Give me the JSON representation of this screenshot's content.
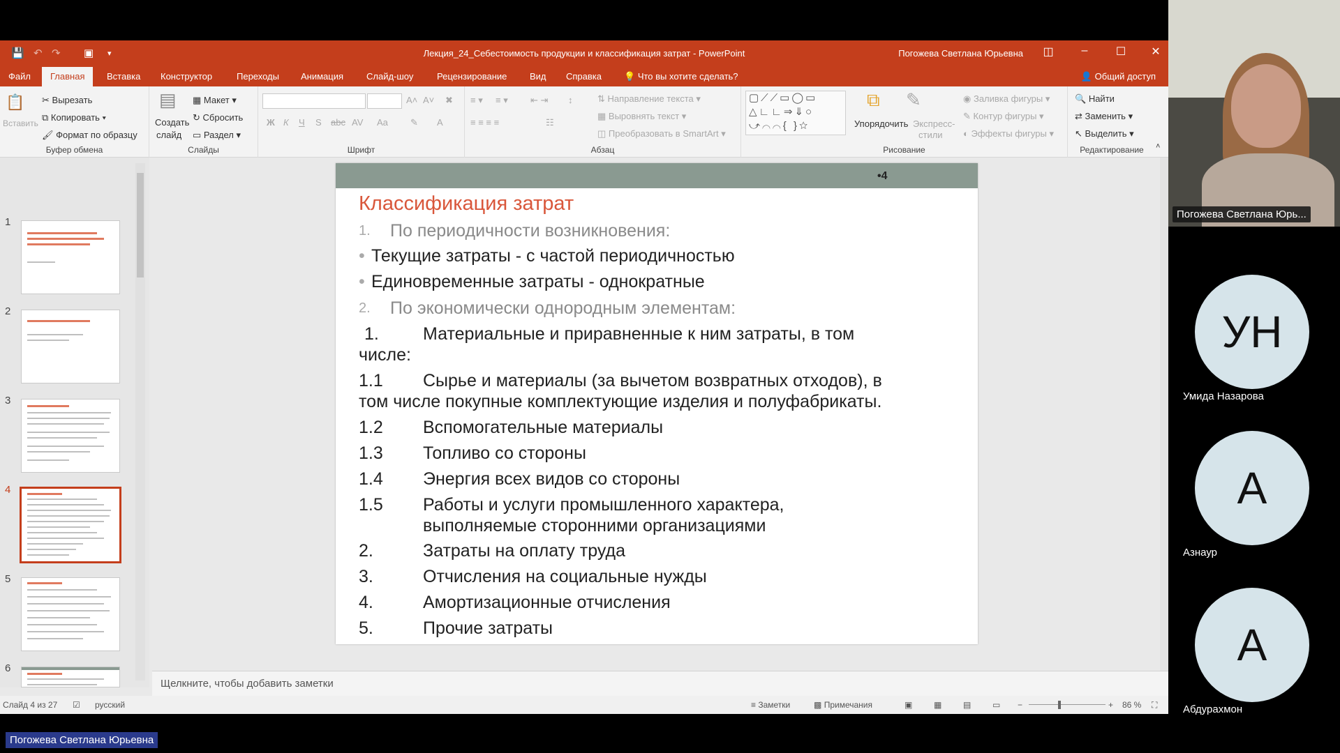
{
  "window": {
    "title": "Лекция_24_Себестоимость продукции и классификация затрат  -  PowerPoint",
    "user": "Погожева Светлана Юрьевна"
  },
  "tabs": [
    "Файл",
    "Главная",
    "Вставка",
    "Конструктор",
    "Переходы",
    "Анимация",
    "Слайд-шоу",
    "Рецензирование",
    "Вид",
    "Справка"
  ],
  "tell_me": "Что вы хотите сделать?",
  "share": "Общий доступ",
  "ribbon": {
    "clipboard": {
      "paste": "Вставить",
      "cut": "Вырезать",
      "copy": "Копировать",
      "format_painter": "Формат по образцу",
      "label": "Буфер обмена"
    },
    "slides": {
      "new_slide_1": "Создать",
      "new_slide_2": "слайд",
      "layout": "Макет",
      "reset": "Сбросить",
      "section": "Раздел",
      "label": "Слайды"
    },
    "font": {
      "label": "Шрифт",
      "bold": "Ж",
      "italic": "К",
      "underline": "Ч",
      "shadow": "S",
      "strike": "abc",
      "spacing": "AV",
      "case": "Aa"
    },
    "paragraph": {
      "text_direction": "Направление текста",
      "align_text": "Выровнять текст",
      "smartart": "Преобразовать в SmartArt",
      "label": "Абзац"
    },
    "drawing": {
      "arrange": "Упорядочить",
      "quick_styles_1": "Экспресс-",
      "quick_styles_2": "стили",
      "shape_fill": "Заливка фигуры",
      "shape_outline": "Контур фигуры",
      "shape_effects": "Эффекты фигуры",
      "label": "Рисование"
    },
    "editing": {
      "find": "Найти",
      "replace": "Заменить",
      "select": "Выделить",
      "label": "Редактирование"
    }
  },
  "thumbnails": [
    "1",
    "2",
    "3",
    "4",
    "5",
    "6"
  ],
  "slide": {
    "number": "•4",
    "title": "Классификация затрат",
    "lines": [
      {
        "no": "1.",
        "text": "По периодичности возникновения:",
        "style": "grey"
      },
      {
        "no": "•",
        "text": "Текущие затраты - с частой периодичностью",
        "style": "bullet"
      },
      {
        "no": "•",
        "text": "Единовременные затраты - однократные",
        "style": "bullet"
      },
      {
        "no": "2.",
        "text": "По экономически однородным элементам:",
        "style": "grey"
      },
      {
        "no": "1.",
        "text": "Материальные и приравненные к ним затраты, в том",
        "cont": "числе:"
      },
      {
        "no": "1.1",
        "text": "Сырье и материалы (за вычетом возвратных отходов), в",
        "cont": "том числе покупные комплектующие изделия и полуфабрикаты."
      },
      {
        "no": "1.2",
        "text": "Вспомогательные материалы"
      },
      {
        "no": "1.3",
        "text": "Топливо со стороны"
      },
      {
        "no": "1.4",
        "text": "Энергия всех видов со стороны"
      },
      {
        "no": "1.5",
        "text": "Работы и услуги промышленного характера,",
        "cont2": "выполняемые сторонними организациями"
      },
      {
        "no": "2.",
        "text": "Затраты на оплату труда"
      },
      {
        "no": "3.",
        "text": "Отчисления на социальные нужды"
      },
      {
        "no": "4.",
        "text": "Амортизационные отчисления"
      },
      {
        "no": "5.",
        "text": "Прочие затраты"
      }
    ]
  },
  "notes_placeholder": "Щелкните, чтобы добавить заметки",
  "status": {
    "slide": "Слайд 4 из 27",
    "language": "русский",
    "notes": "Заметки",
    "comments": "Примечания",
    "zoom": "86 %"
  },
  "participants": {
    "presenter": "Погожева Светлана Юрь...",
    "others": [
      {
        "initials": "УН",
        "name": "Умида Назарова"
      },
      {
        "initials": "А",
        "name": "Азнаур"
      },
      {
        "initials": "А",
        "name": "Абдурахмон"
      }
    ]
  },
  "bottom_label": "Погожева Светлана Юрьевна",
  "colors": {
    "accent": "#c43e1c",
    "slide_title": "#d9573b",
    "band": "#8a9a91"
  }
}
